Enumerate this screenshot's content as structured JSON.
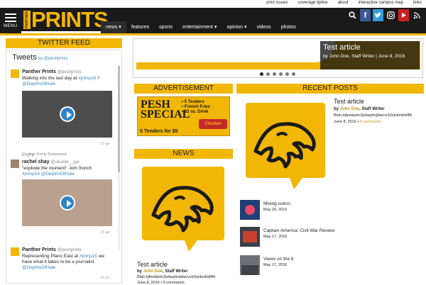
{
  "top_links": [
    "print issues",
    "coverage tipline",
    "about",
    "interactive campus map",
    "links"
  ],
  "menu_label": "MENU",
  "logo": {
    "side_text": "PANTHER",
    "main": "PRINTS"
  },
  "social_icons": [
    "search-icon",
    "facebook-icon",
    "twitter-icon",
    "instagram-icon",
    "youtube-icon",
    "rss-icon"
  ],
  "nav": [
    {
      "label": "news ▾",
      "active": true
    },
    {
      "label": "features"
    },
    {
      "label": "sports"
    },
    {
      "label": "entertainment ▾"
    },
    {
      "label": "opinion ▾"
    },
    {
      "label": "videos"
    },
    {
      "label": "photos"
    }
  ],
  "twitter": {
    "header": "TWITTER FEED",
    "title": "Tweets",
    "by": "by @peshprints",
    "tweets": [
      {
        "name": "Panther Prints",
        "handle": "@peshprints",
        "text_a": "Walking into the last day at ",
        "tag": "#jntnp16",
        "text_b": " ‼",
        "mention": "@DepthsOfHale",
        "time": "19 apr"
      },
      {
        "retweet": "Panther Prints Retweeted",
        "name": "rachel shay",
        "handle": "@ukulele__gal",
        "text_a": "\"explode the moment\" -tom french",
        "mention": "#jntnp16 @DepthsOfHale",
        "time": "19 apr"
      },
      {
        "name": "Panther Prints",
        "handle": "@peshprints",
        "text_a": "Representing Plano East at ",
        "tag": "#jntnp16",
        "text_b": " we have what it takes to be a journalist",
        "mention": "@DepthsOfHale",
        "time": "19 apr"
      }
    ]
  },
  "slider": {
    "title": "Test article",
    "meta": "by John Doe, Staff Writer | June 8, 2016",
    "dots": 6,
    "active_dot": 0
  },
  "advertisement": {
    "header": "ADVERTISEMENT",
    "brand_line1": "PESH",
    "brand_line2": "SPECIAL",
    "items": [
      "• 5 Tenders",
      "• French Fries",
      "• 32 oz. Drink"
    ],
    "badge": "Chicken EXPRESS",
    "footer": "5 Tenders for $5"
  },
  "news": {
    "header": "NEWS",
    "title": "Test article",
    "by_prefix": "by ",
    "author": "John Doe",
    "role": ", Staff Writer",
    "excerpt": "Blah bjfwebjvbr3jvbwjrbvjklwrvcb3rjvbcklrbflfk",
    "date": "June 8, 2016 • 0 comments"
  },
  "recent_posts": {
    "header": "RECENT POSTS",
    "featured": {
      "title": "Test article",
      "by_prefix": "by ",
      "author": "John Doe",
      "role": ", Staff Writer",
      "excerpt": "Blah bjfwebjvbr3jvbwjrbvjklwrvcb3rjvbcklrbflfk",
      "date": "June 8, 2016 • ",
      "comments": "0 comments"
    },
    "items": [
      {
        "title": "Mixing colors",
        "date": "May 26, 2016"
      },
      {
        "title": "Captain America: Civil War Review",
        "date": "May 17, 2016"
      },
      {
        "title": "Views on the 6",
        "date": "May 17, 2016"
      }
    ]
  },
  "colors": {
    "accent": "#f2b705",
    "dark": "#1a1a1a",
    "link": "#3b88c3"
  }
}
